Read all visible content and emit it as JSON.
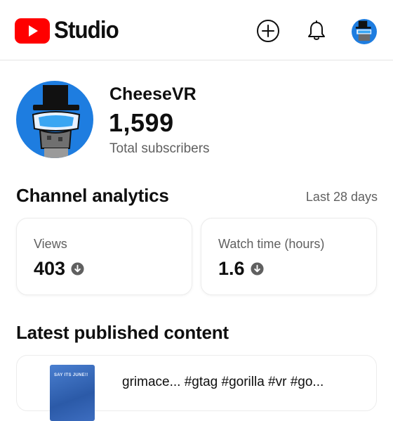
{
  "header": {
    "logo_text": "Studio",
    "brand_color": "#ff0000",
    "icons": [
      "create-icon",
      "notifications-bell-icon",
      "account-avatar"
    ]
  },
  "channel": {
    "name": "CheeseVR",
    "subscribers": "1,599",
    "subscribers_label": "Total subscribers"
  },
  "analytics": {
    "title": "Channel analytics",
    "range": "Last 28 days",
    "cards": [
      {
        "label": "Views",
        "value": "403",
        "trend": "down"
      },
      {
        "label": "Watch time (hours)",
        "value": "1.6",
        "trend": "down"
      }
    ]
  },
  "latest": {
    "title": "Latest published content",
    "video_title": "grimace... #gtag #gorilla #vr #go...",
    "thumb_text": "SAY ITS JUNE!!"
  }
}
